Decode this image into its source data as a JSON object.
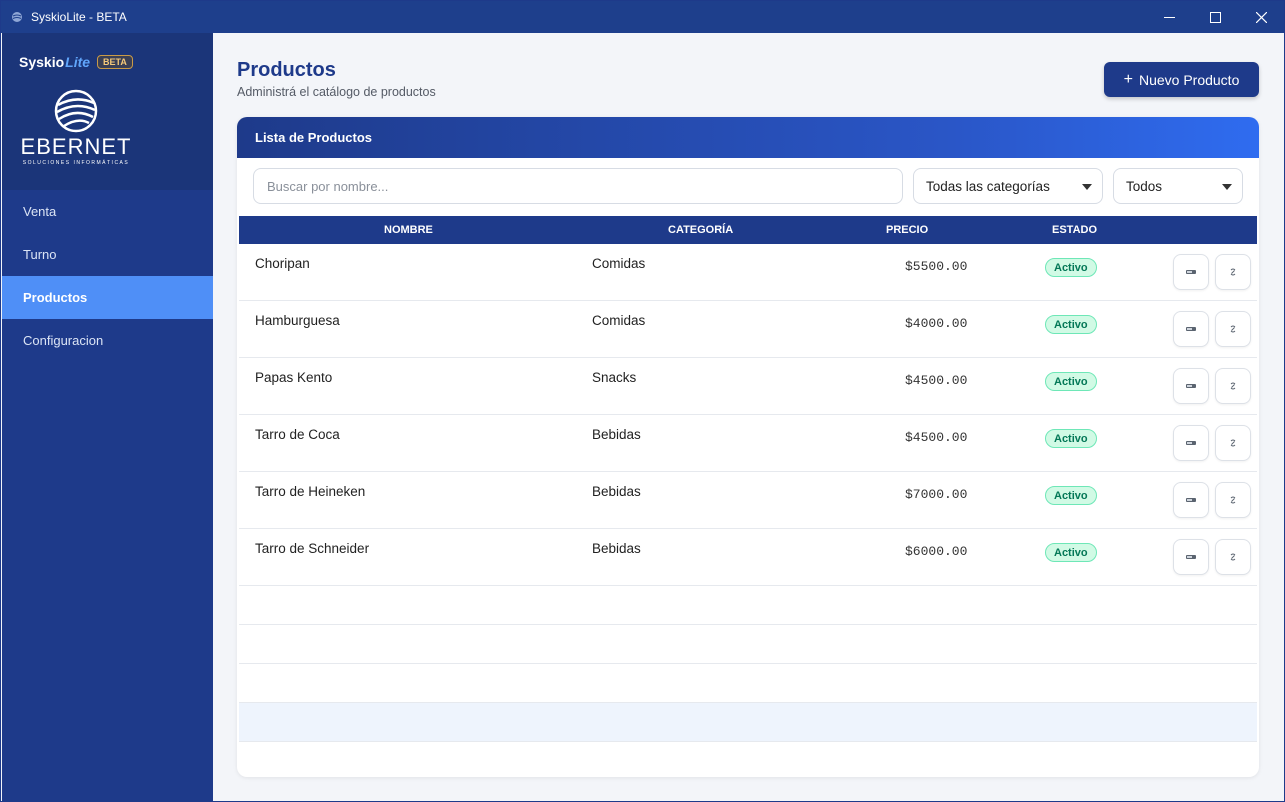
{
  "window": {
    "title": "SyskioLite - BETA",
    "icons": {
      "app": "app-globe-icon",
      "minimize": "minimize-icon",
      "maximize": "maximize-icon",
      "close": "close-icon"
    }
  },
  "sidebar": {
    "brand": {
      "name": "Syskio",
      "lite": "Lite",
      "badge": "BETA"
    },
    "logo": {
      "text": "EBERNET",
      "tagline": "SOLUCIONES INFORMÁTICAS"
    },
    "items": [
      {
        "label": "Venta",
        "active": false
      },
      {
        "label": "Turno",
        "active": false
      },
      {
        "label": "Productos",
        "active": true
      },
      {
        "label": "Configuracion",
        "active": false
      }
    ]
  },
  "header": {
    "title": "Productos",
    "subtitle": "Administrá el catálogo de productos",
    "new_button": {
      "icon": "plus-icon",
      "label": "Nuevo Producto"
    }
  },
  "card": {
    "title": "Lista de Productos",
    "search": {
      "placeholder": "Buscar por nombre...",
      "value": ""
    },
    "category_filter": {
      "selected": "Todas las categorías"
    },
    "status_filter": {
      "selected": "Todos"
    },
    "columns": {
      "name": "NOMBRE",
      "category": "CATEGORÍA",
      "price": "PRECIO",
      "status": "ESTADO"
    },
    "rows": [
      {
        "name": "Choripan",
        "category": "Comidas",
        "price": "$5500.00",
        "status": "Activo"
      },
      {
        "name": "Hamburguesa",
        "category": "Comidas",
        "price": "$4000.00",
        "status": "Activo"
      },
      {
        "name": "Papas Kento",
        "category": "Snacks",
        "price": "$4500.00",
        "status": "Activo"
      },
      {
        "name": "Tarro de Coca",
        "category": "Bebidas",
        "price": "$4500.00",
        "status": "Activo"
      },
      {
        "name": "Tarro de Heineken",
        "category": "Bebidas",
        "price": "$7000.00",
        "status": "Activo"
      },
      {
        "name": "Tarro de Schneider",
        "category": "Bebidas",
        "price": "$6000.00",
        "status": "Activo"
      }
    ],
    "row_actions": {
      "edit": "pencil-icon",
      "toggle": "toggle-status-icon"
    }
  },
  "colors": {
    "primary": "#1e3a8a",
    "accent": "#4f8ff7",
    "active_badge_bg": "#d1fae5",
    "active_badge_text": "#047857"
  }
}
